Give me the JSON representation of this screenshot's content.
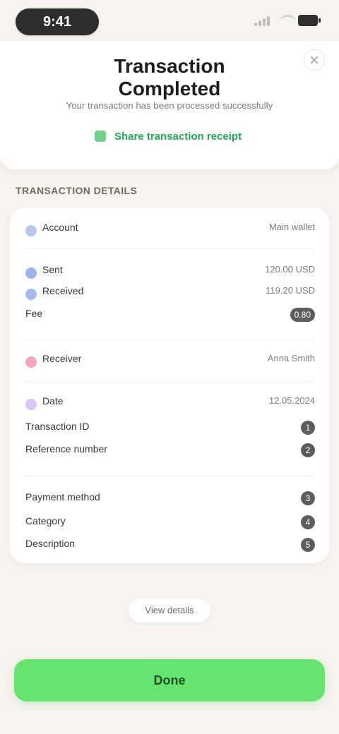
{
  "status_bar": {
    "time": "9:41"
  },
  "header": {
    "title_line_1": "Transaction",
    "title_line_2": "Completed",
    "subtitle": "Your transaction has been processed successfully",
    "share_link": "Share transaction receipt"
  },
  "section": {
    "title": "Transaction details"
  },
  "details": {
    "rows": [
      {
        "label": "Account",
        "value": "Main wallet"
      },
      {
        "label": "Sent",
        "value": "120.00 USD"
      },
      {
        "label": "Received",
        "value": "119.20 USD"
      },
      {
        "label": "Fee",
        "value": "0.80"
      },
      {
        "label": "Receiver",
        "value": "Anna Smith"
      },
      {
        "label": "Date",
        "value": "12.05.2024"
      },
      {
        "label": "Transaction ID",
        "value": "1"
      },
      {
        "label": "Reference number",
        "value": "2"
      },
      {
        "label": "Payment method",
        "value": "3"
      },
      {
        "label": "Category",
        "value": "4"
      },
      {
        "label": "Description",
        "value": "5"
      }
    ]
  },
  "actions": {
    "secondary": "View details",
    "primary": "Done"
  },
  "colors": {
    "background": "#f7f4ef",
    "card": "#ffffff",
    "accent_green": "#66e36f",
    "link_green": "#22a953"
  },
  "icons": {
    "close": "close-icon",
    "share": "share-icon"
  }
}
